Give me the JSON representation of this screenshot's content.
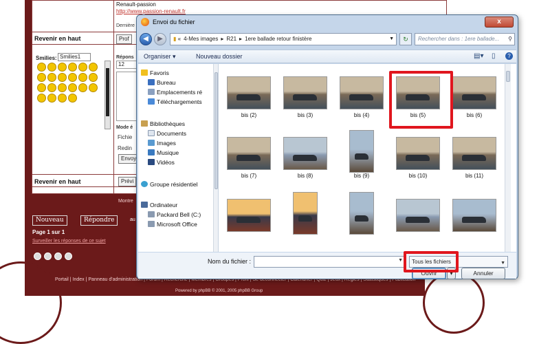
{
  "forum": {
    "signature_name": "Renault-passion",
    "signature_url": "http://www.passion-renault.fr",
    "derniere": "Dernière",
    "back_to_top_1": "Revenir en haut",
    "back_to_top_2": "Revenir en haut",
    "profile_btn": "Prof",
    "smilies_label": "Smilies:",
    "smilies_select": "Smilies1",
    "reply_label": "Répons",
    "mode_label": "Mode é",
    "fichier_label": "Fichie",
    "rediriger_label": "Redin",
    "envoyer_btn": "Envoy",
    "preview_btn": "Prévi",
    "montrer_label": "Montre",
    "font_size": "12",
    "nouveau_btn": "Nouveau",
    "repondre_btn": "Répondre",
    "au_label": "au",
    "page_info": "Page 1 sur 1",
    "watch_link": "Surveiller les réponses de ce sujet",
    "footer_links": "Portail | Index | Panneau d'administration | Forum | Recherche | Membres | Groupes | Profil | Se déconnecter | Calendrier | Quiz | Jeux | Règles | Statistiques | Publication",
    "powered": "Powered by phpBB © 2001, 2005 phpBB Group"
  },
  "dialog": {
    "title": "Envoi du fichier",
    "close_label": "x",
    "path": [
      "«",
      "4-Mes images",
      "▸",
      "R21",
      "▸",
      "1ere ballade retour finistère"
    ],
    "search_placeholder": "Rechercher dans : 1ere ballade...",
    "toolbar": {
      "organize": "Organiser ▾",
      "new_folder": "Nouveau dossier"
    },
    "nav": {
      "favorites": "Favoris",
      "desktop": "Bureau",
      "recent": "Emplacements ré",
      "downloads": "Téléchargements",
      "libraries": "Bibliothèques",
      "documents": "Documents",
      "pictures": "Images",
      "music": "Musique",
      "videos": "Vidéos",
      "homegroup": "Groupe résidentiel",
      "computer": "Ordinateur",
      "drive_c": "Packard Bell (C:)",
      "microsoft": "Microsoft Office"
    },
    "files": [
      {
        "label": "bis (2)",
        "palette": "car"
      },
      {
        "label": "bis (3)",
        "palette": "car"
      },
      {
        "label": "bis (4)",
        "palette": "car"
      },
      {
        "label": "bis (5)",
        "palette": "car"
      },
      {
        "label": "bis (6)",
        "palette": "car"
      },
      {
        "label": "bis (7)",
        "palette": "car"
      },
      {
        "label": "bis (8)",
        "palette": "anchor"
      },
      {
        "label": "bis (9)",
        "palette": "church"
      },
      {
        "label": "bis (10)",
        "palette": "car"
      },
      {
        "label": "bis (11)",
        "palette": "car"
      },
      {
        "label": "",
        "palette": "sunset"
      },
      {
        "label": "",
        "palette": "sunset"
      },
      {
        "label": "",
        "palette": "church"
      },
      {
        "label": "",
        "palette": "anchor"
      },
      {
        "label": "",
        "palette": "church"
      }
    ],
    "filename_label": "Nom du fichier :",
    "filename_value": "",
    "filetype": "Tous les fichiers",
    "open_btn": "Ouvrir",
    "cancel_btn": "Annuler"
  },
  "colors": {
    "forum_maroon": "#6b1a1a",
    "highlight_red": "#e0161e",
    "dialog_chrome": "#c5d6ea"
  }
}
